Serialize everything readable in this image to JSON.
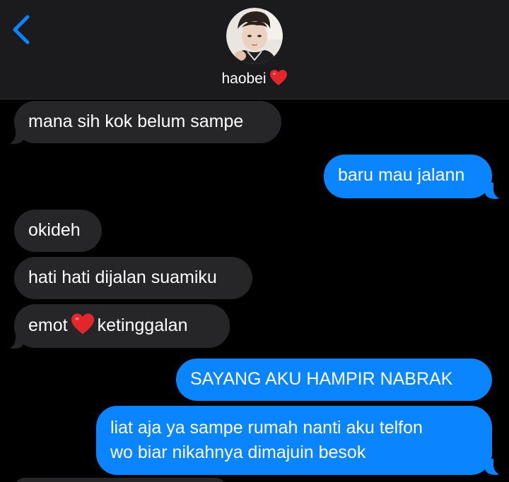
{
  "header": {
    "contact_name": "haobei",
    "name_emoji": "red-heart"
  },
  "messages": [
    {
      "direction": "incoming",
      "text": "mana sih kok belum sampe"
    },
    {
      "direction": "outgoing",
      "text": "baru mau jalann"
    },
    {
      "direction": "incoming",
      "text": "okideh"
    },
    {
      "direction": "incoming",
      "text": "hati hati dijalan suamiku"
    },
    {
      "direction": "incoming",
      "text_before": "emot",
      "emoji": "red-heart",
      "text_after": "ketinggalan"
    },
    {
      "direction": "outgoing",
      "text": "SAYANG AKU HAMPIR NABRAK"
    },
    {
      "direction": "outgoing",
      "lines": [
        "liat aja ya sampe rumah nanti aku telfon",
        "wo biar nikahnya dimajuin besok"
      ]
    }
  ],
  "colors": {
    "background": "#000000",
    "header_background": "#1b1b1d",
    "incoming_bubble": "#262628",
    "outgoing_bubble": "#0a84ff",
    "accent": "#0a84ff",
    "text": "#ffffff"
  },
  "icons": {
    "back": "chevron-left-icon",
    "heart": "red-heart-emoji"
  }
}
